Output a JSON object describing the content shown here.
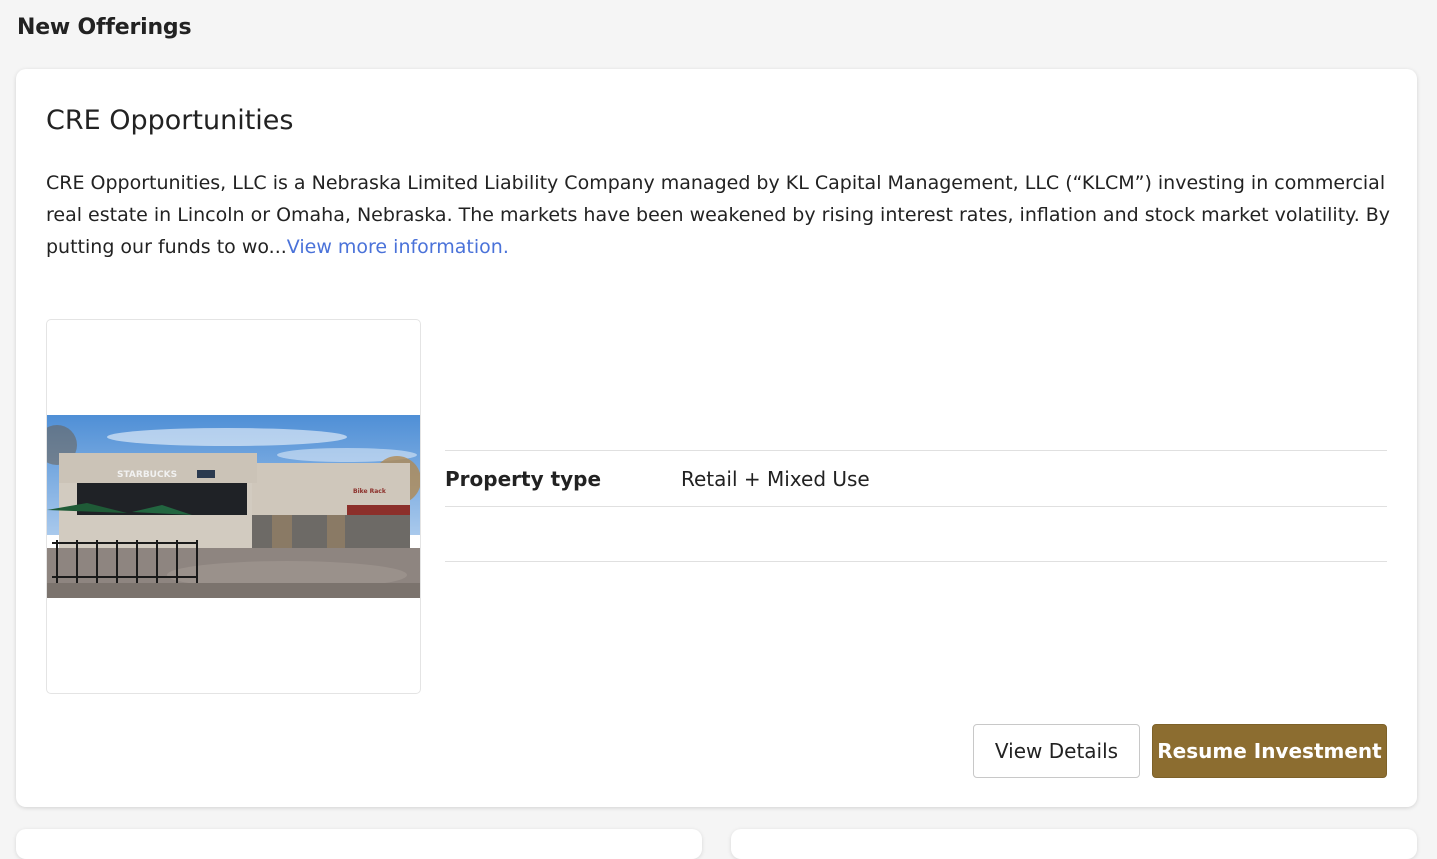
{
  "page": {
    "section_title": "New Offerings"
  },
  "offering": {
    "title": "CRE Opportunities",
    "description": "CRE Opportunities, LLC is a Nebraska Limited Liability Company managed by KL Capital Management, LLC (“KLCM”) investing in commercial real estate in Lincoln or Omaha, Nebraska.  The markets have been weakened by rising interest rates, inflation and stock market volatility. By putting our funds to wo...",
    "more_link": "View more information.",
    "image": {
      "sign_left": "STARBUCKS",
      "sign_right": "Bike Rack"
    },
    "details": [
      {
        "label": "Property type",
        "value": "Retail + Mixed Use"
      },
      {
        "label": "",
        "value": ""
      }
    ],
    "buttons": {
      "view_details": "View Details",
      "resume": "Resume Investment"
    }
  },
  "colors": {
    "accent": "#8c6d30",
    "link": "#4a72d9",
    "background": "#f5f5f5"
  }
}
